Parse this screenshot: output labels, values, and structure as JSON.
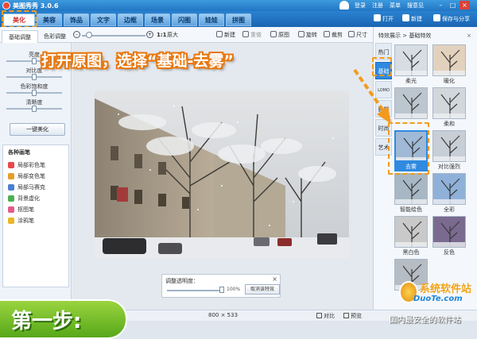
{
  "titlebar": {
    "title": "美图秀秀 3.0.6",
    "links": [
      "登录",
      "注册",
      "菜单",
      "搜意见"
    ],
    "window_buttons": [
      "–",
      "□",
      "×"
    ]
  },
  "main_tabs": [
    "美化",
    "美容",
    "饰品",
    "文字",
    "边框",
    "场景",
    "闪图",
    "娃娃",
    "拼图"
  ],
  "right_buttons": {
    "open": "打开",
    "new": "新建",
    "save": "保存与分享"
  },
  "subtabs": [
    "基础调整",
    "色彩调整"
  ],
  "toolbar": {
    "zoom_ratio": "1:1",
    "original_size": "原大",
    "new": "新建",
    "redo": "重做",
    "original": "原图",
    "rotate": "旋转",
    "crop": "裁剪",
    "size": "尺寸"
  },
  "adjust": {
    "sliders": [
      {
        "label": "亮度",
        "value": 0.5
      },
      {
        "label": "对比度",
        "value": 0.5
      },
      {
        "label": "色彩饱和度",
        "value": 0.5
      },
      {
        "label": "清晰度",
        "value": 0.5
      }
    ],
    "one_key": "一键美化"
  },
  "brushes": {
    "heading": "各种画笔",
    "items": [
      {
        "label": "局部彩色笔",
        "color": "#e8474a"
      },
      {
        "label": "局部变色笔",
        "color": "#e89d2a"
      },
      {
        "label": "局部马赛克",
        "color": "#4a7fd0"
      },
      {
        "label": "背景虚化",
        "color": "#4caf50"
      },
      {
        "label": "抠图笔",
        "color": "#e25c8b"
      },
      {
        "label": "涂鸦笔",
        "color": "#e8b824"
      }
    ]
  },
  "opacity_box": {
    "label": "调整透明度：",
    "percent": "100%",
    "value": 1.0,
    "cancel": "取消该特效",
    "close": "×"
  },
  "status": {
    "dims": "800 × 533",
    "compare": "对比",
    "preview": "预览"
  },
  "effects_panel": {
    "header": "特效展示 > 基础特效",
    "close": "×",
    "categories": [
      "热门",
      "基础",
      "LOMO",
      "影楼",
      "时尚",
      "艺术"
    ],
    "active_category": "基础",
    "thumbnails": [
      {
        "label": "柔光",
        "tint": "#d7dde3"
      },
      {
        "label": "暖化",
        "tint": "#e2d2bd"
      },
      {
        "label": "",
        "tint": "#bcc6cf"
      },
      {
        "label": "柔和",
        "tint": "#d2d7dc"
      },
      {
        "label": "去雾",
        "tint": "#9fb9d6",
        "selected": true
      },
      {
        "label": "对比强烈",
        "tint": "#c8ced6"
      },
      {
        "label": "智能绘色",
        "tint": "#a7b7c3"
      },
      {
        "label": "全彩",
        "tint": "#8fb1d9"
      },
      {
        "label": "黑白色",
        "tint": "#c9c9c9"
      },
      {
        "label": "反色",
        "tint": "#7a6a90"
      },
      {
        "label": "智能",
        "tint": "#b6bcc4"
      }
    ]
  },
  "annotation": "打开原图，选择“基础-去雾”",
  "step_badge": "第一步:",
  "watermark": {
    "name": "系统软件站",
    "url": "DuoTe.com",
    "slogan": "国内最安全的软件站"
  },
  "colors": {
    "accent": "#2f8ae0",
    "highlight": "#f39a1d",
    "step_green": "#6cbb25"
  }
}
